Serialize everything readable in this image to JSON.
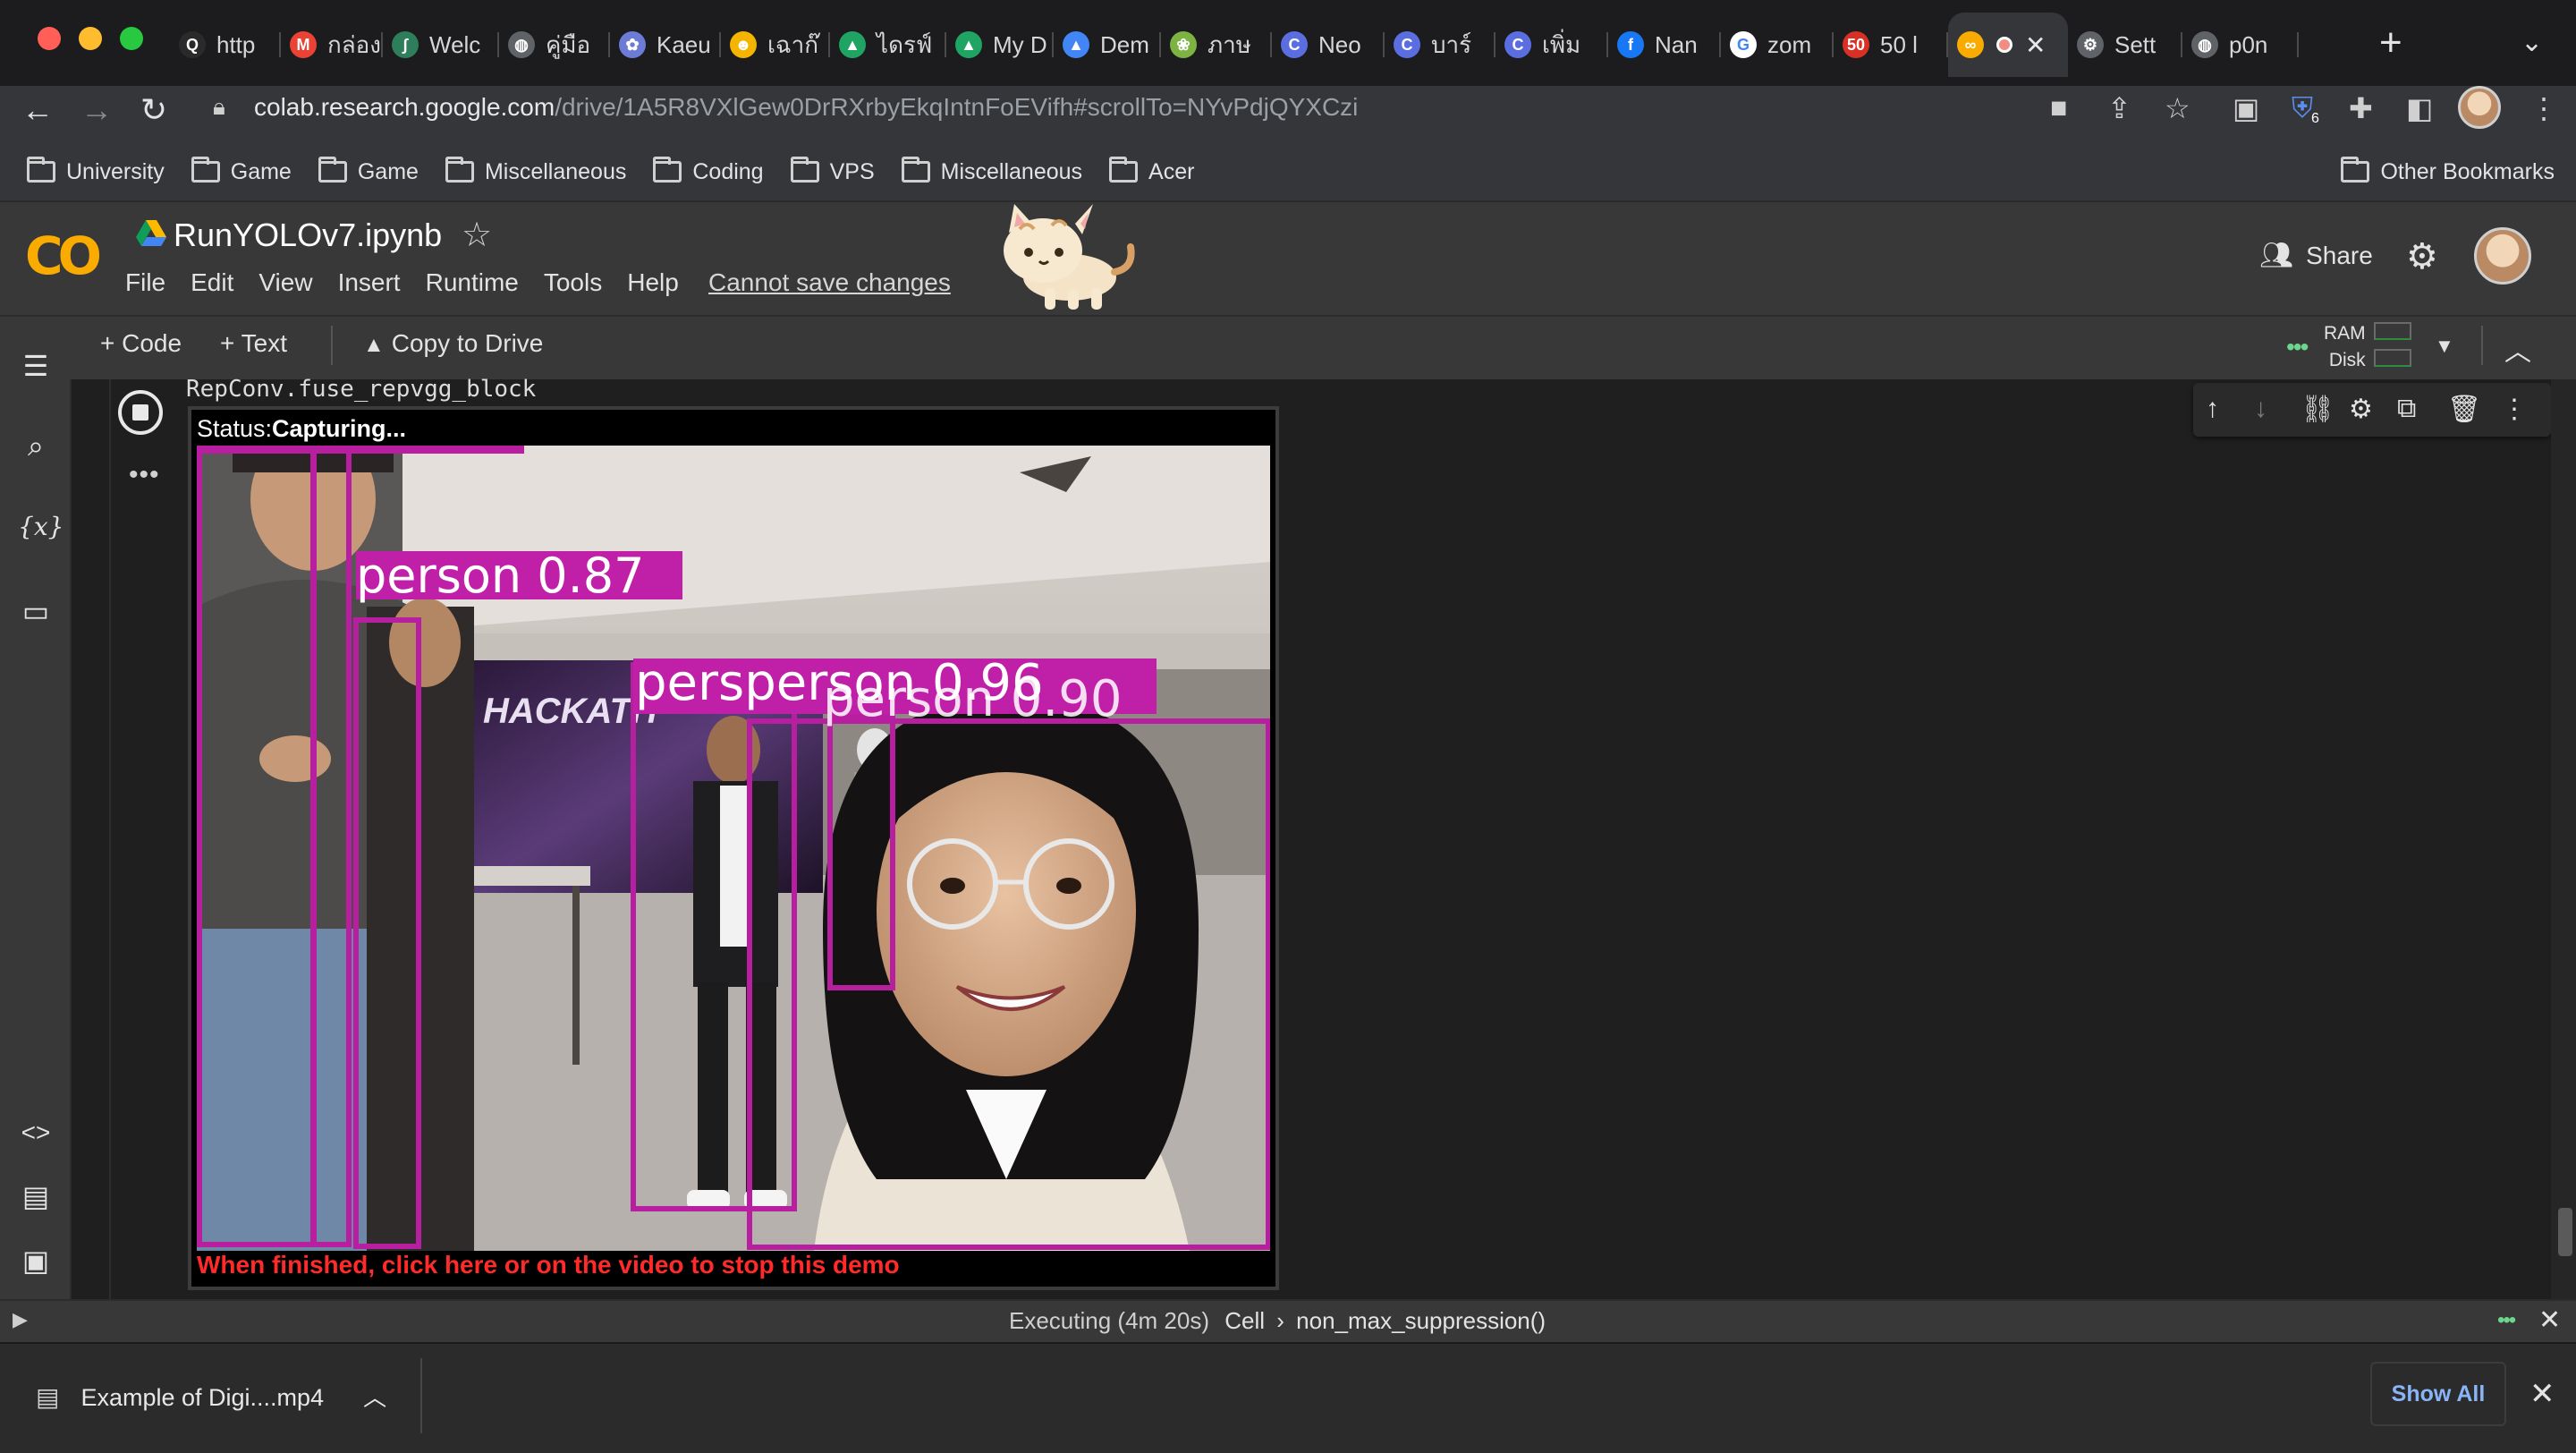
{
  "browser": {
    "tabs": [
      {
        "label": "http",
        "icon": "q-icon",
        "color": "#2a2a2a",
        "glyph": "Q"
      },
      {
        "label": "กล่อง",
        "icon": "gmail-icon",
        "color": "#ea4335",
        "glyph": "M"
      },
      {
        "label": "Welc",
        "icon": "feather-icon",
        "color": "#2e7d5b",
        "glyph": "∫"
      },
      {
        "label": "คู่มือ",
        "icon": "globe-icon",
        "color": "#5f6368",
        "glyph": "◍"
      },
      {
        "label": "Kaeu",
        "icon": "anime-icon",
        "color": "#6b7bd6",
        "glyph": "✿"
      },
      {
        "label": "เฉาก๊",
        "icon": "emoji-icon",
        "color": "#f4b400",
        "glyph": "☻"
      },
      {
        "label": "ไดรฟ์",
        "icon": "drive-icon",
        "color": "#1fa463",
        "glyph": "▲"
      },
      {
        "label": "My D",
        "icon": "drive-icon",
        "color": "#1fa463",
        "glyph": "▲"
      },
      {
        "label": "Dem",
        "icon": "drive-icon",
        "color": "#4285f4",
        "glyph": "▲"
      },
      {
        "label": "ภาษ",
        "icon": "leaf-icon",
        "color": "#7cb342",
        "glyph": "❀"
      },
      {
        "label": "Neo",
        "icon": "c-icon",
        "color": "#5b6ee1",
        "glyph": "C"
      },
      {
        "label": "บาร์",
        "icon": "c-icon",
        "color": "#5b6ee1",
        "glyph": "C"
      },
      {
        "label": "เพิ่ม",
        "icon": "c-icon",
        "color": "#5b6ee1",
        "glyph": "C"
      },
      {
        "label": "Nan",
        "icon": "facebook-icon",
        "color": "#1877f2",
        "glyph": "f"
      },
      {
        "label": "zom",
        "icon": "google-icon",
        "color": "#ffffff",
        "glyph": "G"
      },
      {
        "label": "50 l",
        "icon": "fifty-icon",
        "color": "#d93025",
        "glyph": "50"
      },
      {
        "label": "",
        "icon": "colab-icon",
        "color": "#f9ab00",
        "glyph": "∞",
        "active": true
      },
      {
        "label": "Sett",
        "icon": "gear-icon",
        "color": "#5f6368",
        "glyph": "⚙"
      },
      {
        "label": "p0n",
        "icon": "globe-icon",
        "color": "#5f6368",
        "glyph": "◍"
      }
    ],
    "url_host": "colab.research.google.com",
    "url_path": "/drive/1A5R8VXlGew0DrRXrbyEkqIntnFoEVifh#scrollTo=NYvPdjQYXCzi",
    "bookmarks": [
      "University",
      "Game",
      "Game",
      "Miscellaneous",
      "Coding",
      "VPS",
      "Miscellaneous",
      "Acer"
    ],
    "other_bookmarks": "Other Bookmarks",
    "extension_badge": "6"
  },
  "colab": {
    "title": "RunYOLOv7.ipynb",
    "menu": [
      "File",
      "Edit",
      "View",
      "Insert",
      "Runtime",
      "Tools",
      "Help"
    ],
    "cannot_save": "Cannot save changes",
    "share": "Share",
    "toolbar": {
      "code": "+ Code",
      "text": "+ Text",
      "copy_to_drive": "Copy to Drive",
      "ram": "RAM",
      "disk": "Disk"
    },
    "cell": {
      "output_line": "RepConv.fuse_repvgg_block",
      "status_label": "Status:",
      "status_value": "Capturing...",
      "finish_message": "When finished, click here or on the video to stop this demo"
    },
    "detections": [
      {
        "label": "person 0.87"
      },
      {
        "label": "persperson 0.96"
      },
      {
        "label": "person 0.90"
      }
    ],
    "statusbar": {
      "executing": "Executing (4m 20s)",
      "cell": "Cell",
      "func": "non_max_suppression()"
    }
  },
  "downloads": {
    "file": "Example of Digi....mp4",
    "show_all": "Show All"
  },
  "colors": {
    "accent": "#f9ab00",
    "box": "#c020a8",
    "link": "#8ab4f8",
    "error": "#ff2a2a"
  }
}
